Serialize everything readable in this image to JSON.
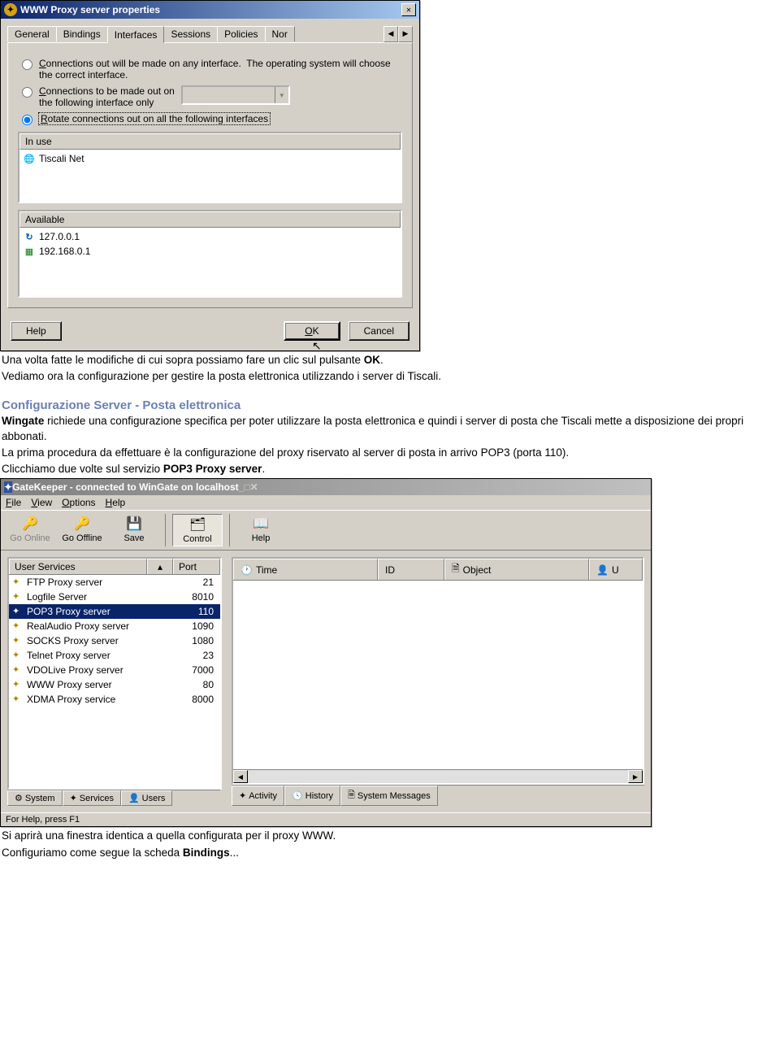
{
  "dialog1": {
    "title": "WWW Proxy server properties",
    "tabs": [
      "General",
      "Bindings",
      "Interfaces",
      "Sessions",
      "Policies",
      "Nor"
    ],
    "active_tab": "Interfaces",
    "radio1": "Connections out will be made on any interface.  The operating system will choose the correct interface.",
    "radio1_mnemonic": "C",
    "radio2": "Connections to be made out on the following interface only",
    "radio2_mnemonic": "C",
    "radio3": "Rotate connections out on all the following interfaces",
    "radio3_mnemonic": "R",
    "inuse_header": "In use",
    "inuse_items": [
      "Tiscali Net"
    ],
    "available_header": "Available",
    "available_items": [
      "127.0.0.1",
      "192.168.0.1"
    ],
    "btn_help": "Help",
    "btn_ok": "OK",
    "btn_ok_mnemonic": "O",
    "btn_cancel": "Cancel"
  },
  "para1_a": "Una volta fatte le modifiche di cui sopra possiamo fare un clic sul pulsante ",
  "para1_b": "OK",
  "para1_c": ".",
  "para2": "Vediamo ora la configurazione per gestire la posta elettronica utilizzando i server di Tiscali.",
  "heading": "Configurazione Server - Posta elettronica",
  "para3_a": "Wingate",
  "para3_b": " richiede una configurazione specifica per poter utilizzare la posta elettronica e quindi i server di posta che Tiscali mette a disposizione dei propri abbonati.",
  "para4": "La prima procedura da effettuare è la configurazione del proxy riservato al server di posta in arrivo POP3 (porta 110).",
  "para5_a": "Clicchiamo due volte sul servizio ",
  "para5_b": "POP3 Proxy server",
  "para5_c": ".",
  "gatekeeper": {
    "title": "GateKeeper - connected to WinGate on localhost",
    "menus": [
      "File",
      "View",
      "Options",
      "Help"
    ],
    "menu_mnemonics": [
      "F",
      "V",
      "O",
      "H"
    ],
    "toolbar": {
      "go_online": "Go Online",
      "go_offline": "Go Offline",
      "save": "Save",
      "control": "Control",
      "help": "Help"
    },
    "services_header": {
      "name": "User Services",
      "port": "Port"
    },
    "services": [
      {
        "name": "FTP Proxy server",
        "port": "21"
      },
      {
        "name": "Logfile Server",
        "port": "8010"
      },
      {
        "name": "POP3 Proxy server",
        "port": "110",
        "selected": true
      },
      {
        "name": "RealAudio Proxy server",
        "port": "1090"
      },
      {
        "name": "SOCKS Proxy server",
        "port": "1080"
      },
      {
        "name": "Telnet Proxy server",
        "port": "23"
      },
      {
        "name": "VDOLive Proxy server",
        "port": "7000"
      },
      {
        "name": "WWW Proxy server",
        "port": "80"
      },
      {
        "name": "XDMA Proxy service",
        "port": "8000"
      }
    ],
    "left_tabs": [
      "System",
      "Services",
      "Users"
    ],
    "right_header": {
      "time": "Time",
      "id": "ID",
      "object": "Object",
      "user": "U"
    },
    "right_tabs": [
      "Activity",
      "History",
      "System Messages"
    ],
    "statusbar": "For Help, press F1"
  },
  "para6": "Si aprirà una finestra identica a quella configurata per il proxy WWW.",
  "para7_a": "Configuriamo come segue la scheda ",
  "para7_b": "Bindings",
  "para7_c": "..."
}
